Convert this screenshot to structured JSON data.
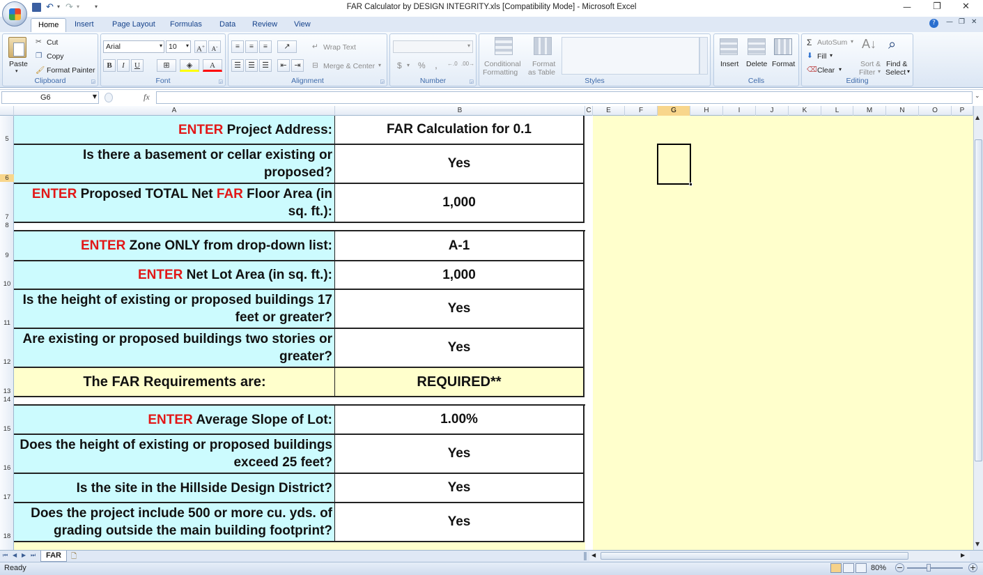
{
  "window": {
    "title": "FAR Calculator by DESIGN INTEGRITY.xls  [Compatibility Mode] - Microsoft Excel",
    "minimize": "—",
    "restore": "❐",
    "close": "✕"
  },
  "ribbon": {
    "tabs": [
      "Home",
      "Insert",
      "Page Layout",
      "Formulas",
      "Data",
      "Review",
      "View"
    ],
    "clipboard": {
      "paste": "Paste",
      "cut": "Cut",
      "copy": "Copy",
      "format_painter": "Format Painter",
      "name": "Clipboard"
    },
    "font": {
      "family": "Arial",
      "size": "10",
      "name": "Font",
      "bold": "B",
      "italic": "I",
      "underline": "U"
    },
    "alignment": {
      "wrap": "Wrap Text",
      "merge": "Merge & Center",
      "name": "Alignment"
    },
    "number": {
      "name": "Number",
      "currency": "$",
      "percent": "%",
      "comma": ","
    },
    "styles": {
      "conditional_1": "Conditional",
      "conditional_2": "Formatting",
      "format_table_1": "Format",
      "format_table_2": "as Table",
      "name": "Styles"
    },
    "cells": {
      "insert": "Insert",
      "delete": "Delete",
      "format": "Format",
      "name": "Cells"
    },
    "editing": {
      "autosum": "AutoSum",
      "fill": "Fill",
      "clear": "Clear",
      "sort_1": "Sort &",
      "sort_2": "Filter",
      "find_1": "Find &",
      "find_2": "Select",
      "name": "Editing"
    }
  },
  "formula_bar": {
    "name_box": "G6",
    "fx": "fx",
    "value": ""
  },
  "columns": [
    "A",
    "B",
    "C",
    "E",
    "F",
    "G",
    "H",
    "I",
    "J",
    "K",
    "L",
    "M",
    "N",
    "O",
    "P"
  ],
  "rows": [
    {
      "num": "5",
      "enter": "ENTER",
      "label": " Project Address:",
      "value": "FAR Calculation for 0.1"
    },
    {
      "num": "6",
      "enter": "",
      "label": "Is there a basement or cellar existing or proposed?",
      "value": "Yes"
    },
    {
      "num": "7",
      "enter": "ENTER",
      "label": " Proposed TOTAL Net ",
      "label_red2": "FAR",
      "label_tail": " Floor Area (in sq. ft.):",
      "value": "1,000"
    },
    {
      "num": "8"
    },
    {
      "num": "9",
      "enter": "ENTER",
      "label": " Zone ONLY from drop-down list:",
      "value": "A-1"
    },
    {
      "num": "10",
      "enter": "ENTER",
      "label": " Net Lot Area (in sq. ft.):",
      "value": "1,000"
    },
    {
      "num": "11",
      "enter": "",
      "label": "Is the height of existing or proposed buildings 17 feet or greater?",
      "value": "Yes"
    },
    {
      "num": "12",
      "enter": "",
      "label": "Are existing or proposed buildings two stories or greater?",
      "value": "Yes"
    },
    {
      "num": "13",
      "enter": "",
      "label": "The FAR Requirements are:",
      "value": "REQUIRED**"
    },
    {
      "num": "14"
    },
    {
      "num": "15",
      "enter": "ENTER",
      "label": " Average Slope of Lot:",
      "value": "1.00%"
    },
    {
      "num": "16",
      "enter": "",
      "label": "Does the height of existing or proposed buildings exceed 25 feet?",
      "value": "Yes"
    },
    {
      "num": "17",
      "enter": "",
      "label": "Is the site in the Hillside Design District?",
      "value": "Yes"
    },
    {
      "num": "18",
      "enter": "",
      "label": "Does the project include 500 or more cu. yds. of grading outside the main building footprint?",
      "value": "Yes"
    }
  ],
  "sheet_tabs": [
    "FAR"
  ],
  "status": {
    "ready": "Ready",
    "zoom": "80%"
  },
  "colors": {
    "cyan_cell": "#ccfbfe",
    "yellow_area": "#ffffcc",
    "enter_red": "#e21717"
  }
}
